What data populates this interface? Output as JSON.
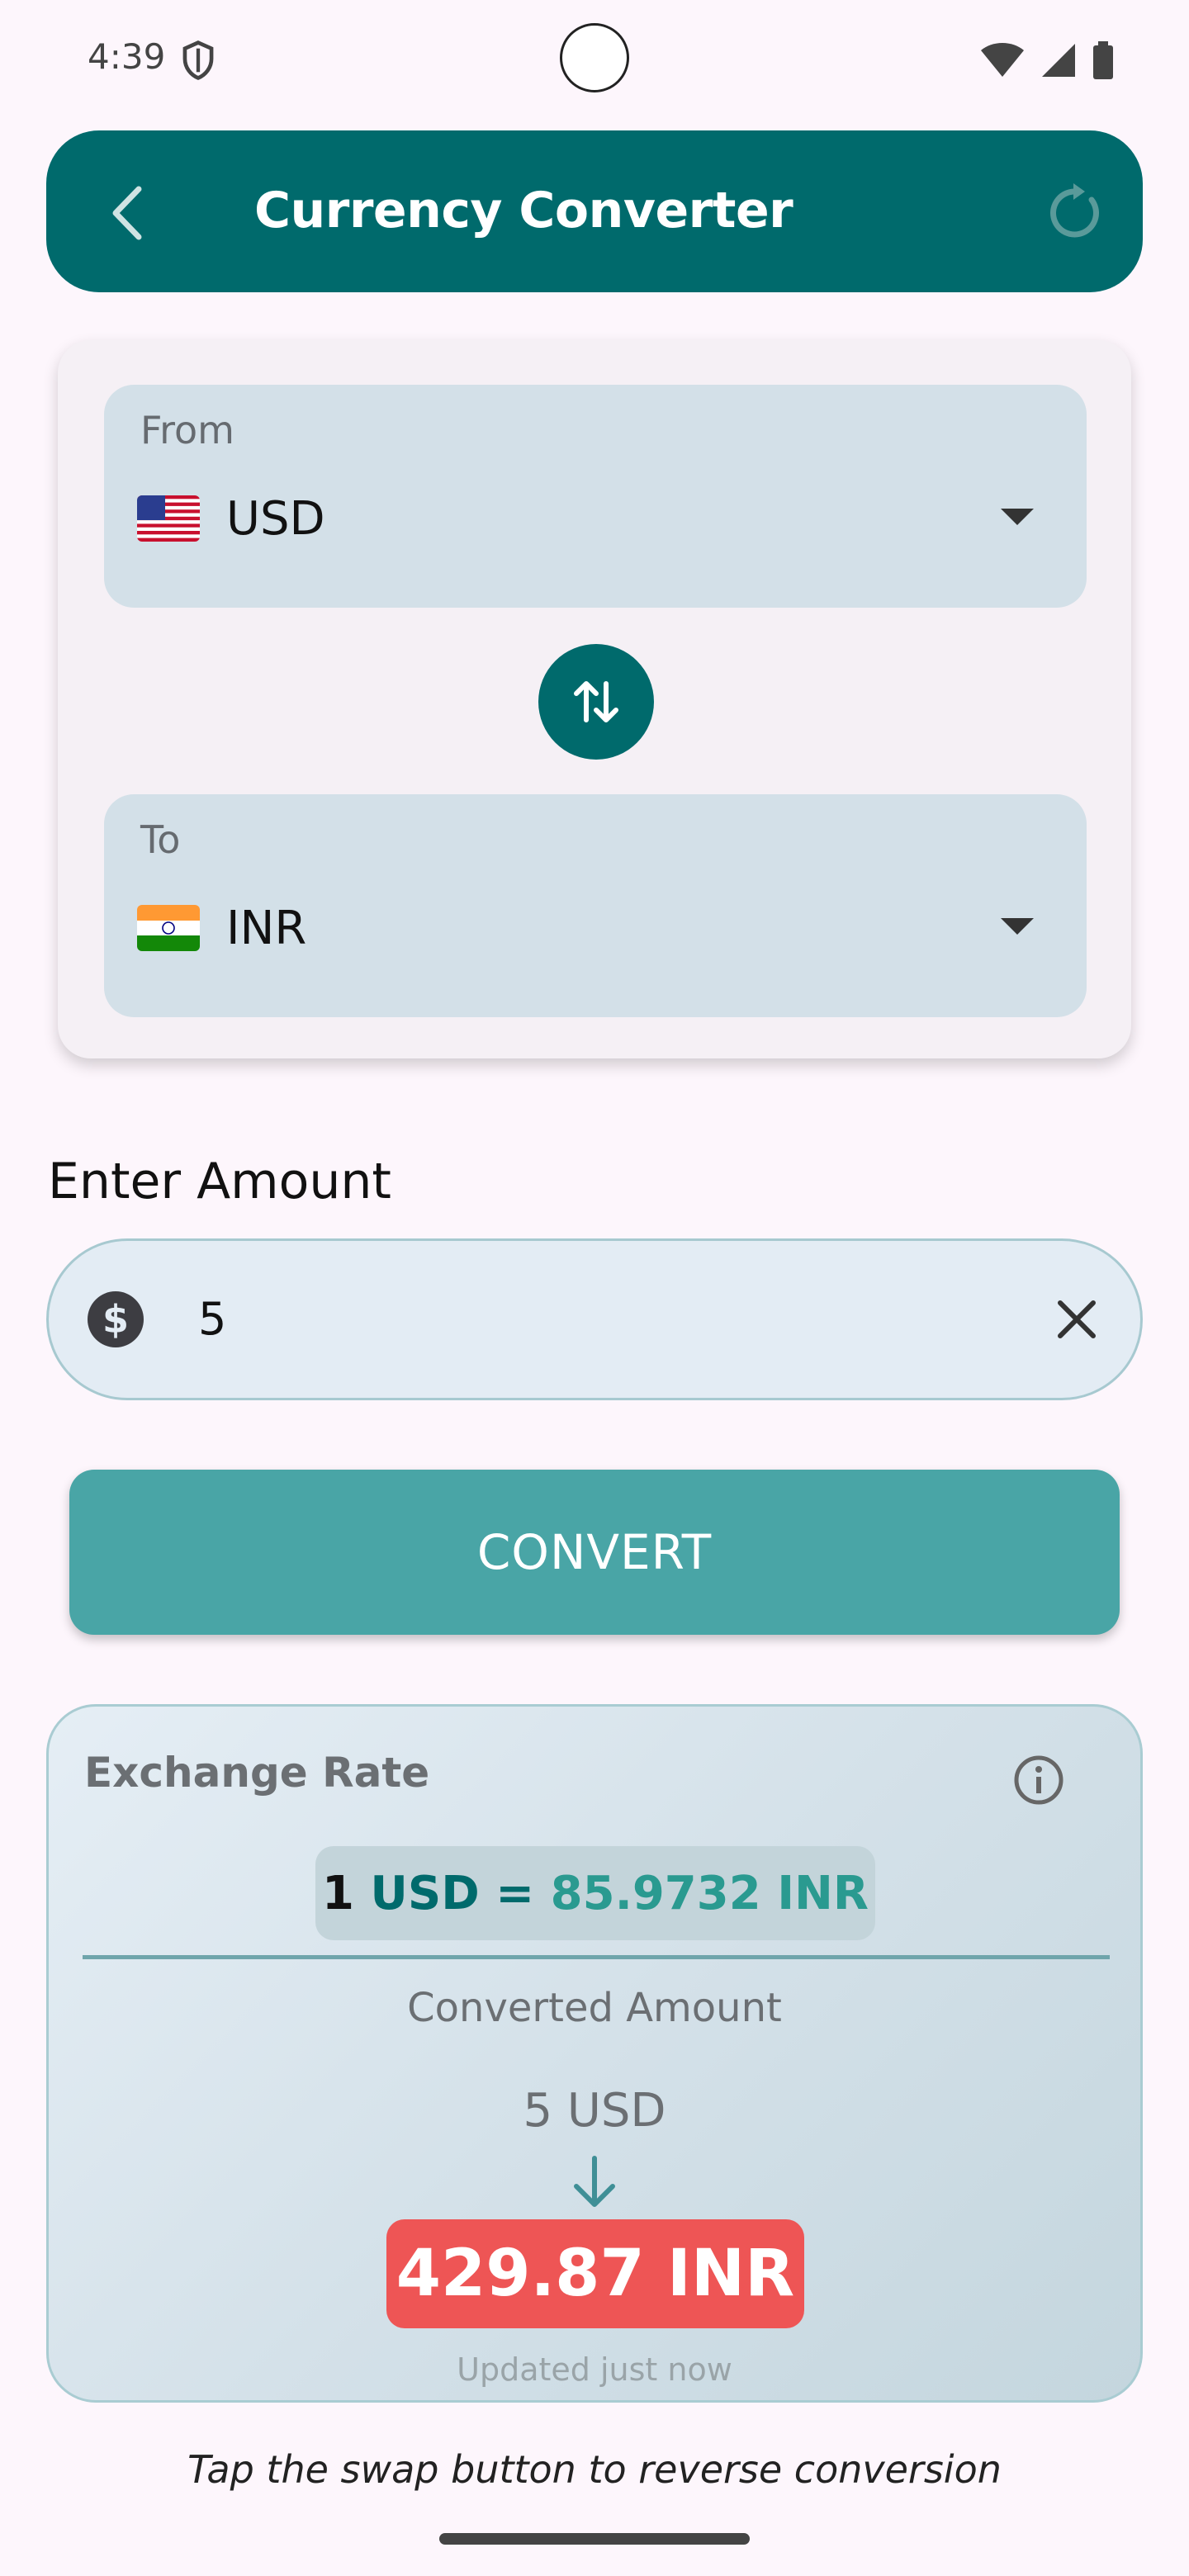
{
  "status_bar": {
    "time": "4:39"
  },
  "app_bar": {
    "title": "Currency Converter",
    "back_icon": "chevron-left",
    "refresh_icon": "refresh"
  },
  "from": {
    "label": "From",
    "currency": "USD",
    "flag": "US flag"
  },
  "to": {
    "label": "To",
    "currency": "INR",
    "flag": "India flag"
  },
  "amount": {
    "heading": "Enter Amount",
    "value": "5"
  },
  "convert_label": "CONVERT",
  "result": {
    "rate_label": "Exchange Rate",
    "rate_part1": "1",
    "rate_part2": "USD =",
    "rate_part3": "85.9732 INR",
    "converted_label": "Converted Amount",
    "from_amount": "5 USD",
    "to_amount": "429.87 INR",
    "updated": "Updated just now"
  },
  "hint": "Tap the swap button to reverse conversion",
  "colors": {
    "primary": "#006a6c",
    "button": "#49a5a6",
    "result_accent": "#ee5555",
    "field_bg": "#d3e0e8"
  }
}
